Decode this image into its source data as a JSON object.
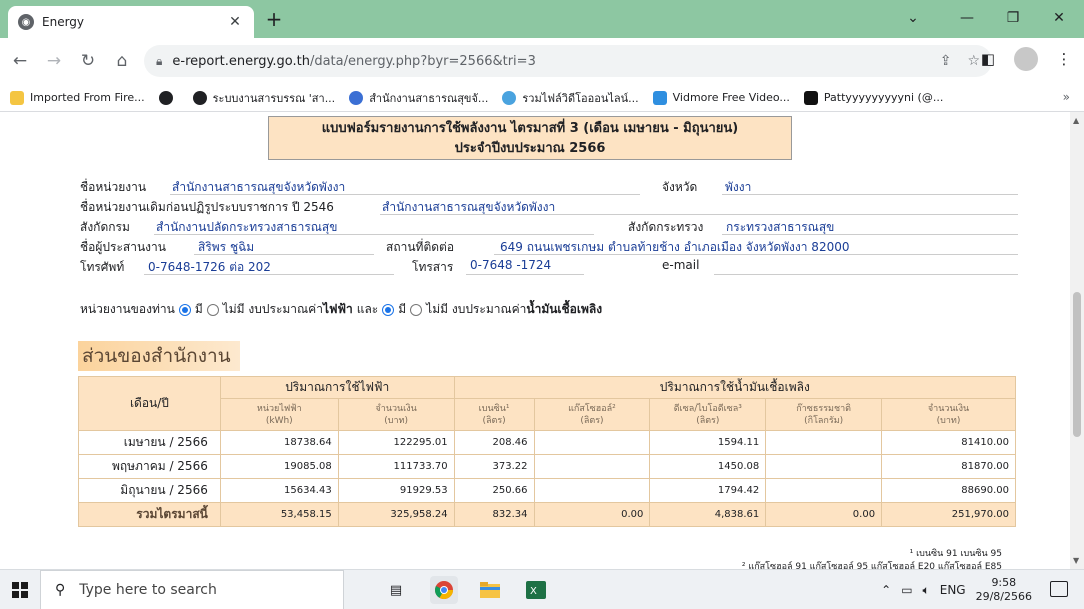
{
  "browser": {
    "tab_title": "Energy",
    "tab_icon": "globe-icon",
    "url_host": "e-report.energy.go.th",
    "url_path": "/data/energy.php?byr=2566&tri=3",
    "bookmarks": [
      {
        "label": "Imported From Fire...",
        "color": "#f4c542"
      },
      {
        "label": "",
        "color": "#202124"
      },
      {
        "label": "ระบบงานสารบรรณ 'สา...",
        "color": "#202124"
      },
      {
        "label": "สำนักงานสาธารณสุขจั...",
        "color": "#3b6fd4"
      },
      {
        "label": "รวมไฟล์วิดีโอออนไลน์...",
        "color": "#4aa3df"
      },
      {
        "label": "Vidmore Free Video...",
        "color": "#2f8fe0"
      },
      {
        "label": "Pattyyyyyyyyyni (@...",
        "color": "#111111"
      }
    ],
    "more_bookmarks": "»"
  },
  "form": {
    "title_line1": "แบบฟอร์มรายงานการใช้พลังงาน ไตรมาสที่ 3 (เดือน เมษายน - มิถุนายน)",
    "title_line2": "ประจำปีงบประมาณ 2566"
  },
  "info": {
    "agency_label": "ชื่อหน่วยงาน",
    "agency_value": "สำนักงานสาธารณสุขจังหวัดพังงา",
    "province_label": "จังหวัด",
    "province_value": "พังงา",
    "old_name_label": "ชื่อหน่วยงานเดิมก่อนปฏิรูประบบราชการ ปี 2546",
    "old_name_value": "สำนักงานสาธารณสุขจังหวัดพังงา",
    "dept_label": "สังกัดกรม",
    "dept_value": "สำนักงานปลัดกระทรวงสาธารณสุข",
    "ministry_label": "สังกัดกระทรวง",
    "ministry_value": "กระทรวงสาธารณสุข",
    "coordinator_label": "ชื่อผู้ประสานงาน",
    "coordinator_value": "สิริพร ชูฉิม",
    "address_label": "สถานที่ติดต่อ",
    "address_value": "649 ถนนเพชรเกษม ตำบลท้ายช้าง อำเภอเมือง จังหวัดพังงา 82000",
    "phone_label": "โทรศัพท์",
    "phone_value": "0-7648-1726 ต่อ 202",
    "fax_label": "โทรสาร",
    "fax_value": "0-7648 -1724",
    "email_label": "e-mail",
    "email_value": ""
  },
  "budget": {
    "prefix": "หน่วยงานของท่าน",
    "opt_yes": "มี",
    "opt_no": "ไม่มี งบประมาณค่า",
    "electric": "ไฟฟ้า",
    "and": "และ",
    "fuel": "น้ำมันเชื้อเพลิง",
    "electric_selected": "yes",
    "fuel_selected": "yes"
  },
  "section_title": "ส่วนของสำนักงาน",
  "table": {
    "month_header": "เดือน/ปี",
    "electric_group": "ปริมาณการใช้ไฟฟ้า",
    "fuel_group": "ปริมาณการใช้น้ำมันเชื้อเพลิง",
    "sub_headers": [
      {
        "name": "หน่วยไฟฟ้า",
        "unit": "(kWh)"
      },
      {
        "name": "จำนวนเงิน",
        "unit": "(บาท)"
      },
      {
        "name": "เบนซิน¹",
        "unit": "(ลิตร)"
      },
      {
        "name": "แก๊สโซฮอล์²",
        "unit": "(ลิตร)"
      },
      {
        "name": "ดีเซล/ไบโอดีเซล³",
        "unit": "(ลิตร)"
      },
      {
        "name": "ก๊าซธรรมชาติ",
        "unit": "(กิโลกรัม)"
      },
      {
        "name": "จำนวนเงิน",
        "unit": "(บาท)"
      }
    ],
    "rows": [
      {
        "month": "เมษายน / 2566",
        "kwh": "18738.64",
        "elec_baht": "122295.01",
        "benzine": "208.46",
        "gasohol": "",
        "diesel": "1594.11",
        "ngv": "",
        "fuel_baht": "81410.00"
      },
      {
        "month": "พฤษภาคม / 2566",
        "kwh": "19085.08",
        "elec_baht": "111733.70",
        "benzine": "373.22",
        "gasohol": "",
        "diesel": "1450.08",
        "ngv": "",
        "fuel_baht": "81870.00"
      },
      {
        "month": "มิถุนายน / 2566",
        "kwh": "15634.43",
        "elec_baht": "91929.53",
        "benzine": "250.66",
        "gasohol": "",
        "diesel": "1794.42",
        "ngv": "",
        "fuel_baht": "88690.00"
      }
    ],
    "total": {
      "month": "รวมไตรมาสนี้",
      "kwh": "53,458.15",
      "elec_baht": "325,958.24",
      "benzine": "832.34",
      "gasohol": "0.00",
      "diesel": "4,838.61",
      "ngv": "0.00",
      "fuel_baht": "251,970.00"
    }
  },
  "footnotes": [
    "¹ เบนซิน 91 เบนซิน 95",
    "² แก๊สโซฮอล์ 91 แก๊สโซฮอล์ 95 แก๊สโซฮอล์ E20 แก๊สโซฮอล์ E85"
  ],
  "taskbar": {
    "search_placeholder": "Type here to search",
    "lang": "ENG",
    "time": "9:58",
    "date": "29/8/2566"
  }
}
